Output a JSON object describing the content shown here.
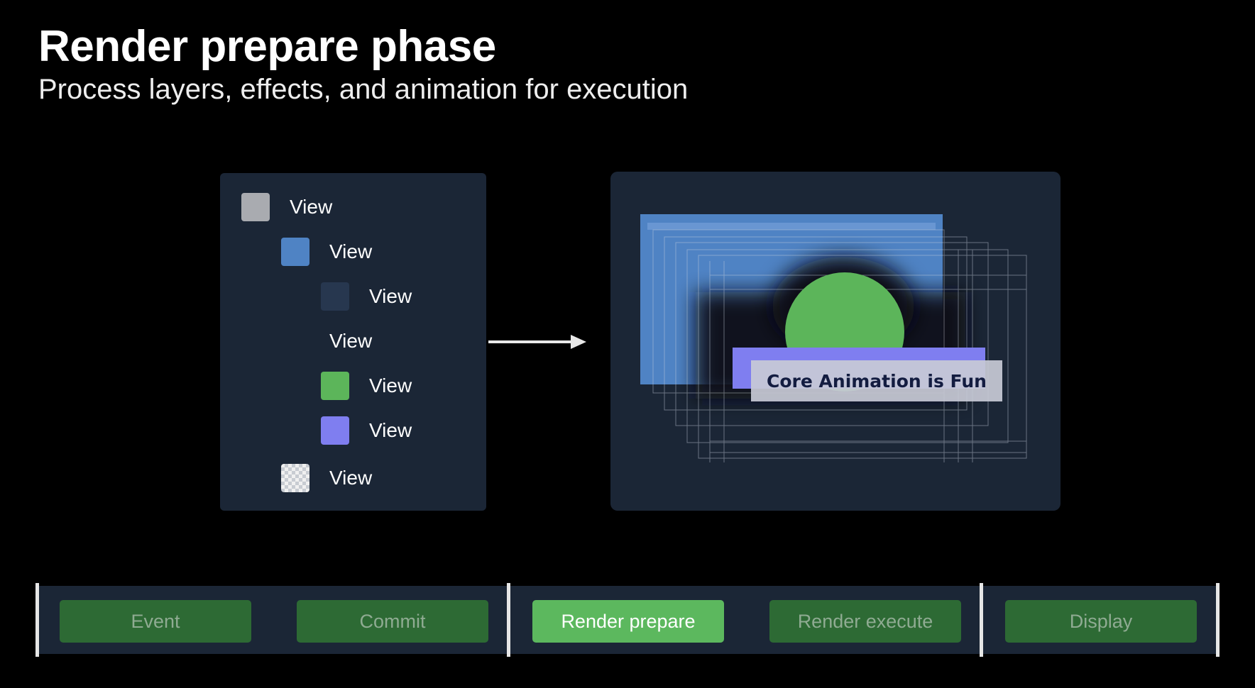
{
  "header": {
    "title": "Render prepare phase",
    "subtitle": "Process layers, effects, and animation for execution"
  },
  "view_tree": {
    "items": [
      {
        "label": "View",
        "swatch": "gray",
        "color": "#a9abb0"
      },
      {
        "label": "View",
        "swatch": "blue",
        "color": "#4f83c4"
      },
      {
        "label": "View",
        "swatch": "navy",
        "color": "#27374f"
      },
      {
        "label": "View",
        "swatch": "none",
        "color": ""
      },
      {
        "label": "View",
        "swatch": "green",
        "color": "#5cb55a"
      },
      {
        "label": "View",
        "swatch": "purple",
        "color": "#7f7ef0"
      },
      {
        "label": "View",
        "swatch": "checker",
        "color": "#f0f0f0"
      }
    ]
  },
  "render_preview": {
    "caption": "Core Animation is Fun"
  },
  "pipeline": {
    "stages": [
      {
        "label": "Event",
        "active": false
      },
      {
        "label": "Commit",
        "active": false
      },
      {
        "label": "Render prepare",
        "active": true
      },
      {
        "label": "Render execute",
        "active": false
      },
      {
        "label": "Display",
        "active": false
      }
    ]
  },
  "colors": {
    "background": "#000000",
    "panel": "#1b2636",
    "stage_inactive": "#2d6a34",
    "stage_active": "#5cb85e",
    "accent_blue": "#4f83c4",
    "accent_green": "#5cb55a",
    "accent_purple": "#7f7ef0"
  }
}
